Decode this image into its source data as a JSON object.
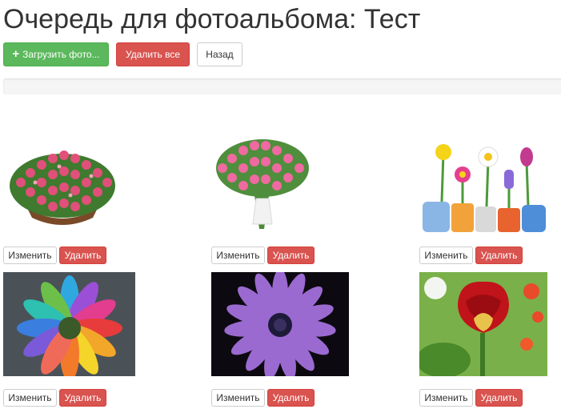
{
  "page": {
    "title": "Очередь для фотоальбома: Тест"
  },
  "toolbar": {
    "upload_label": "Загрузить фото...",
    "delete_all_label": "Удалить все",
    "back_label": "Назад"
  },
  "progress": {
    "value": 0
  },
  "photos": [
    {
      "subject": "pink-roses-basket",
      "edit_label": "Изменить",
      "delete_label": "Удалить"
    },
    {
      "subject": "pink-roses-bouquet",
      "edit_label": "Изменить",
      "delete_label": "Удалить"
    },
    {
      "subject": "flowers-in-pots",
      "edit_label": "Изменить",
      "delete_label": "Удалить"
    },
    {
      "subject": "rainbow-gerbera",
      "edit_label": "Изменить",
      "delete_label": "Удалить"
    },
    {
      "subject": "purple-daisy",
      "edit_label": "Изменить",
      "delete_label": "Удалить"
    },
    {
      "subject": "red-rose-heart",
      "edit_label": "Изменить",
      "delete_label": "Удалить"
    }
  ],
  "colors": {
    "success": "#5cb85c",
    "danger": "#d9534f",
    "default_border": "#cccccc",
    "progress_track": "#f5f5f5"
  }
}
